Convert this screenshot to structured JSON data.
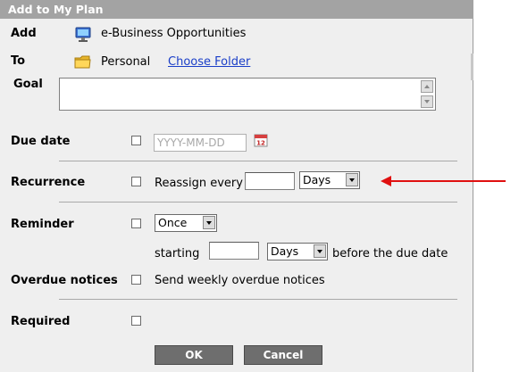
{
  "dialog": {
    "title": "Add to My Plan"
  },
  "add": {
    "label": "Add",
    "value": "e-Business Opportunities",
    "icon": "computer-icon"
  },
  "to": {
    "label": "To",
    "value": "Personal",
    "icon": "folder-icon",
    "choose_folder": "Choose Folder"
  },
  "goal": {
    "label": "Goal",
    "value": ""
  },
  "due_date": {
    "label": "Due date",
    "checked": false,
    "placeholder": "YYYY-MM-DD",
    "calendar_icon": "calendar-icon",
    "calendar_day": "12"
  },
  "recurrence": {
    "label": "Recurrence",
    "checked": false,
    "text": "Reassign every",
    "value": "",
    "unit": "Days"
  },
  "reminder": {
    "label": "Reminder",
    "checked": false,
    "frequency": "Once",
    "starting_label": "starting",
    "value": "",
    "unit": "Days",
    "suffix": "before the due date"
  },
  "overdue": {
    "label": "Overdue notices",
    "checked": false,
    "text": "Send weekly overdue notices"
  },
  "required": {
    "label": "Required",
    "checked": false
  },
  "buttons": {
    "ok": "OK",
    "cancel": "Cancel"
  },
  "annotation": {
    "arrow_color": "#e01010"
  },
  "colors": {
    "titlebar": "#a3a3a3",
    "panel": "#efefef",
    "button": "#6e6e6e",
    "link": "#1a3ec8"
  }
}
